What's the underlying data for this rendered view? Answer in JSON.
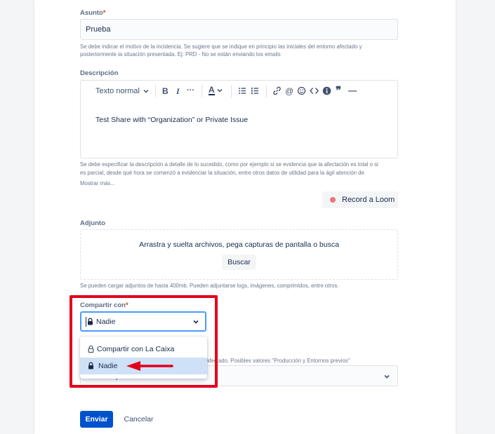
{
  "form": {
    "subject": {
      "label": "Asunto",
      "required_mark": "*",
      "value": "Prueba",
      "help_line1": "Se debe indicar el motivo de la incidencia. Se sugiere que se indique en principio las iniciales del entorno afectado y",
      "help_line2": "posteriormente la situación presentada. Ej: PRD - No se están enviando los emails"
    },
    "description": {
      "label": "Descripción",
      "toolbar": {
        "text_style": "Texto normal",
        "bold": "B",
        "italic": "I",
        "more": "···",
        "text_color": "A",
        "link": "🔗",
        "mention": "@",
        "emoji": "☺",
        "code": "<>",
        "info": "i",
        "quote": "❞",
        "divider": "—"
      },
      "body": "Test Share with “Organization” or Private Issue",
      "help_line1": "Se debe especificar la descripción a detalle de lo sucedido, como por ejemplo si se evidencia que la afectación es total o si",
      "help_line2": "es parcial, desde qué hora se comenzó a evidenciar la situación, entre otros datos de utilidad para la ágil atención de",
      "show_more": "Mostrar más..."
    },
    "loom": {
      "label": "Record a Loom"
    },
    "attachment": {
      "label": "Adjunto",
      "dropzone_text": "Arrastra y suelta archivos, pega capturas de pantalla o busca",
      "browse_button": "Buscar",
      "help": "Se pueden cargar adjuntos de hasta 400mb. Pueden adjuntarse logs, imágenes, comprimidos, entre otros."
    },
    "share_with": {
      "label": "Compartir con",
      "required_mark": "*",
      "selected": "Nadie",
      "options": [
        "Compartir con La Caixa",
        "Nadie"
      ]
    },
    "environment": {
      "help_partial": "afectado. Posibles valores \"Producción y Entornos previos\"",
      "value_partial": "Entornos previos"
    },
    "actions": {
      "submit": "Enviar",
      "cancel": "Cancelar"
    }
  },
  "colors": {
    "primary": "#0052cc",
    "highlight_red": "#e3001b",
    "selected_option_bg": "#cfe1f7"
  }
}
